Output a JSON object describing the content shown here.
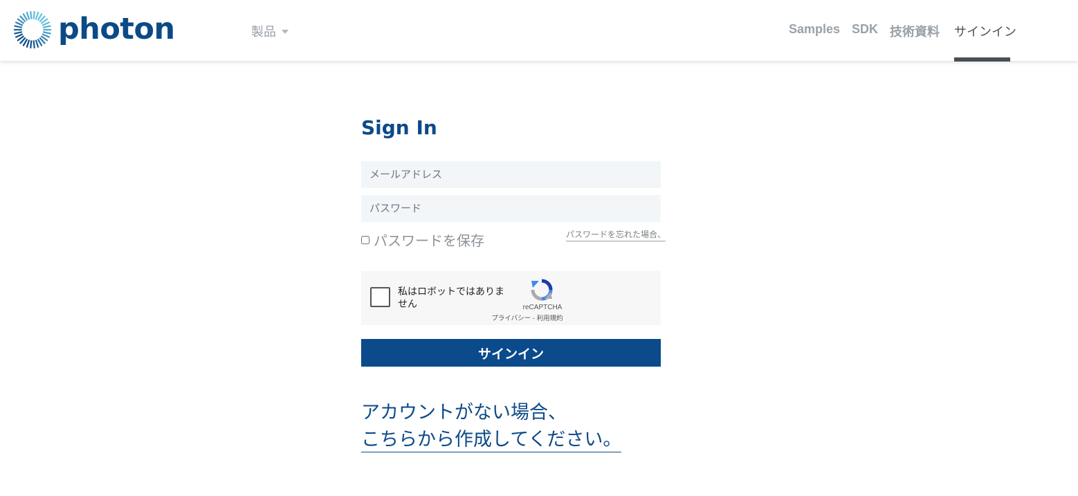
{
  "header": {
    "logo_text": "photon",
    "products_label": "製品",
    "nav": {
      "samples": "Samples",
      "sdk": "SDK",
      "docs": "技術資料",
      "signin": "サインイン"
    }
  },
  "form": {
    "title": "Sign In",
    "email_placeholder": "メールアドレス",
    "password_placeholder": "パスワード",
    "remember_label": "パスワードを保存",
    "forgot_link": "パスワードを忘れた場合、",
    "captcha": {
      "label": "私はロボットではありません",
      "brand": "reCAPTCHA",
      "links": "プライバシー - 利用規約"
    },
    "submit_label": "サインイン",
    "no_account_text": "アカウントがない場合、",
    "create_link": "こちらから作成してください。"
  },
  "colors": {
    "brand_blue": "#0b4a8b",
    "nav_gray": "#9aa1a8",
    "input_bg": "#f3f6f8"
  },
  "icons": {
    "logo": "photon-ring-logo",
    "caret": "chevron-down-icon",
    "captcha": "recaptcha-icon"
  }
}
